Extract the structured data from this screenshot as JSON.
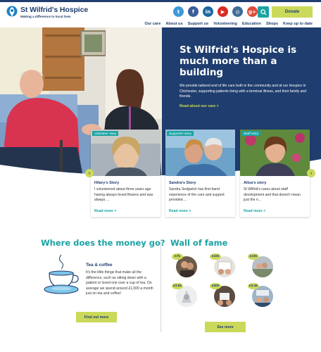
{
  "header": {
    "logo_name": "St Wilfrid's Hospice",
    "logo_tagline": "Making a difference to local lives",
    "donate_label": "Donate",
    "socials": [
      {
        "name": "twitter-icon",
        "glyph": "t",
        "color": "#3d9ad8"
      },
      {
        "name": "facebook-icon",
        "glyph": "f",
        "color": "#3b5b9a"
      },
      {
        "name": "linkedin-icon",
        "glyph": "in",
        "color": "#1c69a1"
      },
      {
        "name": "youtube-icon",
        "glyph": "▶",
        "color": "#d92c23"
      },
      {
        "name": "instagram-icon",
        "glyph": "◎",
        "color": "#3e6d96"
      },
      {
        "name": "google-plus-icon",
        "glyph": "g+",
        "color": "#dd4b39"
      }
    ],
    "nav": [
      "Our care",
      "About us",
      "Support us",
      "Volunteering",
      "Education",
      "Shops",
      "Keep up to date"
    ]
  },
  "hero": {
    "title": "St Wilfrid's Hospice is much more than a building",
    "text": "We provide tailored end of life care both in the community and at our Hospice in Chichester, supporting patients living with a terminal illness, and their family and friends.",
    "link": "Read about our care >"
  },
  "stories": [
    {
      "tag": "Volunteer story",
      "title": "Hilary's Story",
      "text": "I volunteered about three years ago having always loved flowers and was always ...",
      "link": "Read more >"
    },
    {
      "tag": "Supporter story",
      "title": "Sandra's Story",
      "text": "Sandra Sedgwick has first-hand experience of the care and support provided ...",
      "link": "Read more >"
    },
    {
      "tag": "Staff story",
      "title": "Alisa's story",
      "text": "St Wilfrid's cares about staff development and that doesn't mean just the n...",
      "link": "Read more >"
    }
  ],
  "money": {
    "title": "Where does the money go?",
    "item_title": "Tea & coffee",
    "item_text": "It's the little things that make all the difference, such as sitting down with a patient or loved one over a cup of tea. On average we spend around £1,000 a month just on tea and coffee!",
    "button": "Find out more"
  },
  "wall": {
    "title": "Wall of fame",
    "badges": [
      "£7k",
      "£10k",
      "£10k",
      "£3.6k",
      "£500",
      "£3.4k"
    ],
    "button": "See more"
  },
  "colors": {
    "navy": "#1f3d6e",
    "teal": "#1aa3a3",
    "lime": "#cbd95a"
  }
}
